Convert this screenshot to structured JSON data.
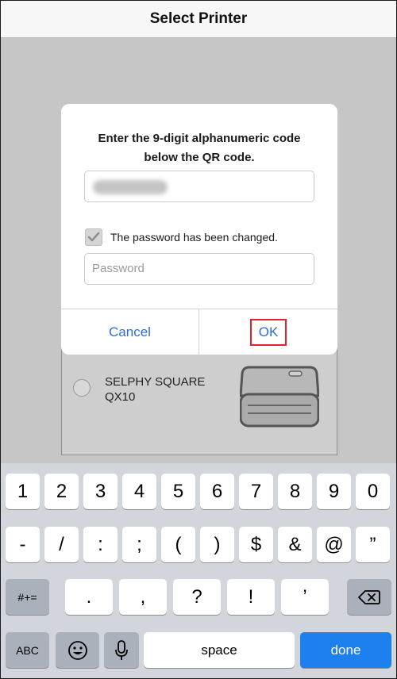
{
  "nav": {
    "title": "Select Printer"
  },
  "dialog": {
    "prompt_line1": "Enter the 9-digit alphanumeric code",
    "prompt_line2": "below the QR code.",
    "checkbox_label": "The password has been changed.",
    "password_placeholder": "Password",
    "cancel_label": "Cancel",
    "ok_label": "OK"
  },
  "printer": {
    "name_line1": "SELPHY SQUARE",
    "name_line2": "QX10"
  },
  "keyboard": {
    "row1": [
      "1",
      "2",
      "3",
      "4",
      "5",
      "6",
      "7",
      "8",
      "9",
      "0"
    ],
    "row2": [
      "-",
      "/",
      ":",
      ";",
      "(",
      ")",
      "$",
      "&",
      "@",
      "”"
    ],
    "symbols_label": "#+=",
    "row3": [
      ".",
      ",",
      "?",
      "!",
      "’"
    ],
    "abc_label": "ABC",
    "space_label": "space",
    "done_label": "done"
  },
  "colors": {
    "accent_link": "#2a6fd6",
    "highlight_box": "#e4222c",
    "done_key": "#1d80ef"
  }
}
